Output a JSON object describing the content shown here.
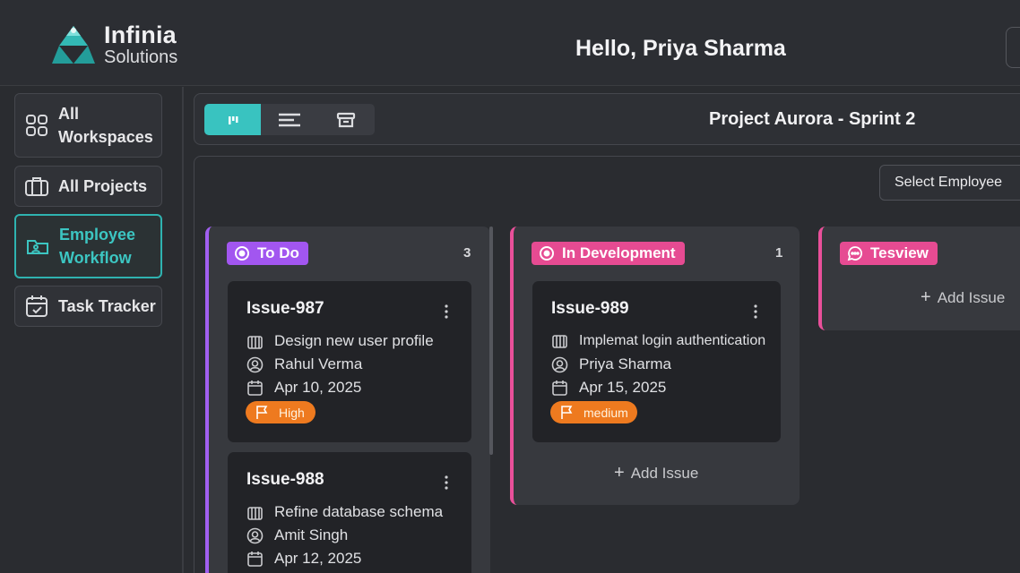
{
  "brand": {
    "name": "Infinia",
    "sub": "Solutions",
    "accent": "#2fb3b0"
  },
  "header": {
    "greeting": "Hello, Priya Sharma"
  },
  "sidebar": {
    "items": [
      {
        "label": "All Workspaces",
        "icon": "grid-icon",
        "active": false
      },
      {
        "label": "All Projects",
        "icon": "briefcase-icon",
        "active": false
      },
      {
        "label": "Employee Workflow",
        "icon": "folder-user-icon",
        "active": true
      },
      {
        "label": "Task Tracker",
        "icon": "calendar-check-icon",
        "active": false
      }
    ]
  },
  "toolbar": {
    "views": [
      "board-view-icon",
      "list-view-icon",
      "archive-icon"
    ],
    "active_view": 0,
    "project_title": "Project Aurora - Sprint 2"
  },
  "board": {
    "select_employee": "Select Employee",
    "add_issue": "Add Issue",
    "columns": [
      {
        "name": "To Do",
        "count": "3",
        "color": "#a256f0",
        "cards": [
          {
            "id": "Issue-987",
            "title": "Design new user profile",
            "assignee": "Rahul Verma",
            "date": "Apr 10, 2025",
            "priority": "High"
          },
          {
            "id": "Issue-988",
            "title": "Refine database schema",
            "assignee": "Amit Singh",
            "date": "Apr 12, 2025"
          }
        ]
      },
      {
        "name": "In Development",
        "count": "1",
        "color": "#e64b92",
        "cards": [
          {
            "id": "Issue-989",
            "title": "Implemat login authentication",
            "assignee": "Priya Sharma",
            "date": "Apr 15, 2025",
            "priority": "medium"
          }
        ]
      },
      {
        "name": "Tesview",
        "color": "#e64b92",
        "cards": []
      }
    ]
  }
}
